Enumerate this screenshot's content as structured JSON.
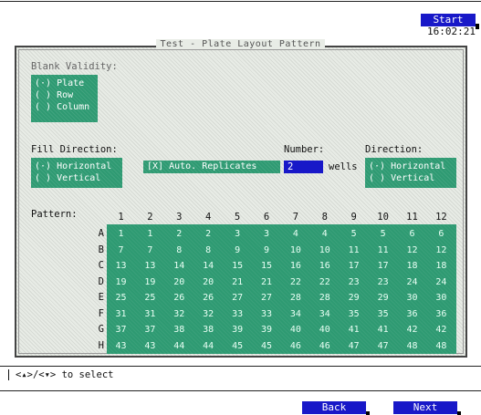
{
  "header": {
    "start_meas_label": "Start Meas",
    "time": "16:02:21"
  },
  "panel": {
    "title": "Test - Plate Layout Pattern"
  },
  "blank_validity": {
    "label": "Blank Validity:",
    "options": [
      "(·) Plate",
      "( ) Row",
      "( ) Column"
    ],
    "selected": "Plate"
  },
  "fill_direction": {
    "label": "Fill Direction:",
    "options": [
      "(·) Horizontal",
      "( ) Vertical"
    ],
    "selected": "Horizontal"
  },
  "auto_replicates": {
    "label": "[X] Auto. Replicates",
    "checked": true
  },
  "number": {
    "label": "Number:",
    "value": "2",
    "unit": "wells"
  },
  "direction": {
    "label": "Direction:",
    "options": [
      "(·) Horizontal",
      "( ) Vertical"
    ],
    "selected": "Horizontal"
  },
  "pattern": {
    "label": "Pattern:",
    "columns": [
      "1",
      "2",
      "3",
      "4",
      "5",
      "6",
      "7",
      "8",
      "9",
      "10",
      "11",
      "12"
    ],
    "rows": [
      "A",
      "B",
      "C",
      "D",
      "E",
      "F",
      "G",
      "H"
    ],
    "values": [
      [
        "1",
        "1",
        "2",
        "2",
        "3",
        "3",
        "4",
        "4",
        "5",
        "5",
        "6",
        "6"
      ],
      [
        "7",
        "7",
        "8",
        "8",
        "9",
        "9",
        "10",
        "10",
        "11",
        "11",
        "12",
        "12"
      ],
      [
        "13",
        "13",
        "14",
        "14",
        "15",
        "15",
        "16",
        "16",
        "17",
        "17",
        "18",
        "18"
      ],
      [
        "19",
        "19",
        "20",
        "20",
        "21",
        "21",
        "22",
        "22",
        "23",
        "23",
        "24",
        "24"
      ],
      [
        "25",
        "25",
        "26",
        "26",
        "27",
        "27",
        "28",
        "28",
        "29",
        "29",
        "30",
        "30"
      ],
      [
        "31",
        "31",
        "32",
        "32",
        "33",
        "33",
        "34",
        "34",
        "35",
        "35",
        "36",
        "36"
      ],
      [
        "37",
        "37",
        "38",
        "38",
        "39",
        "39",
        "40",
        "40",
        "41",
        "41",
        "42",
        "42"
      ],
      [
        "43",
        "43",
        "44",
        "44",
        "45",
        "45",
        "46",
        "46",
        "47",
        "47",
        "48",
        "48"
      ]
    ]
  },
  "status": {
    "hint": "<▴>/<▾> to select"
  },
  "footer": {
    "back_label": "Back",
    "next_label": "Next"
  },
  "colors": {
    "accent_blue": "#1818c8",
    "cell_green": "#2e9a72"
  }
}
